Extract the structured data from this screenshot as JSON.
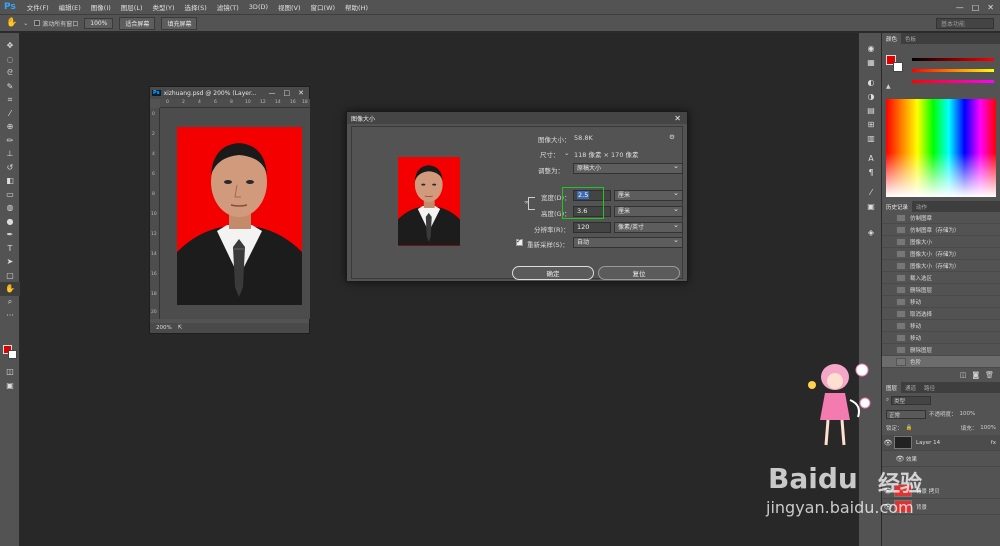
{
  "app": {
    "logo": "Ps"
  },
  "menu": [
    "文件(F)",
    "编辑(E)",
    "图像(I)",
    "图层(L)",
    "类型(Y)",
    "选择(S)",
    "滤镜(T)",
    "3D(D)",
    "视图(V)",
    "窗口(W)",
    "帮助(H)"
  ],
  "window_controls": {
    "min": "—",
    "max": "□",
    "close": "✕"
  },
  "options_bar": {
    "scroll_all_label": "滚动所有窗口",
    "zoom_100": "100%",
    "fit_screen": "适合屏幕",
    "fill_screen": "填充屏幕",
    "workspace": "基本功能"
  },
  "document": {
    "title": "xizhuang.psd @ 200% (Layer...",
    "zoom": "200%",
    "ruler_top": [
      "0",
      "2",
      "4",
      "6",
      "8",
      "10",
      "12",
      "14",
      "16",
      "18"
    ],
    "ruler_left": [
      "0",
      "2",
      "4",
      "6",
      "8",
      "10",
      "12",
      "14",
      "16",
      "18",
      "20"
    ]
  },
  "dialog": {
    "title": "图像大小",
    "close": "✕",
    "image_size_label": "图像大小：",
    "image_size_value": "58.8K",
    "dimensions_label": "尺寸：",
    "dimensions_value": "118 像素 × 170 像素",
    "fit_to_label": "调整为：",
    "fit_to_value": "原稿大小",
    "width_label": "宽度(D)：",
    "width_value": "2.5",
    "width_unit": "厘米",
    "height_label": "高度(G)：",
    "height_value": "3.6",
    "height_unit": "厘米",
    "resolution_label": "分辨率(R)：",
    "resolution_value": "120",
    "resolution_unit": "像素/英寸",
    "resample_label": "重新采样(S)：",
    "resample_value": "自动",
    "ok_label": "确定",
    "cancel_label": "复位"
  },
  "color_panel": {
    "tabs": [
      "颜色",
      "色板"
    ],
    "foreground": "#e00000",
    "background": "#ffffff"
  },
  "history_panel": {
    "tabs": [
      "历史记录",
      "动作"
    ],
    "items": [
      "仿制图章",
      "仿制图章（存储为）",
      "图像大小",
      "图像大小（存储为）",
      "图像大小（存储为）",
      "载入选区",
      "删除图层",
      "移动",
      "取消选择",
      "移动",
      "移动",
      "删除图层",
      "色阶"
    ]
  },
  "layers_panel": {
    "tabs": [
      "图层",
      "通道",
      "路径"
    ],
    "kind": "类型",
    "blend": "正常",
    "opacity_label": "不透明度：",
    "opacity": "100%",
    "lock_label": "锁定：",
    "fill_label": "填充：",
    "fill": "100%",
    "layers": [
      {
        "name": "Layer 14",
        "fx": "fx"
      },
      {
        "name": "效果"
      },
      {
        "name": "背景 拷贝"
      },
      {
        "name": "背景"
      }
    ]
  },
  "watermark": {
    "brand": "Bai",
    "brand2": "经验",
    "url": "jingyan.baidu.com"
  }
}
